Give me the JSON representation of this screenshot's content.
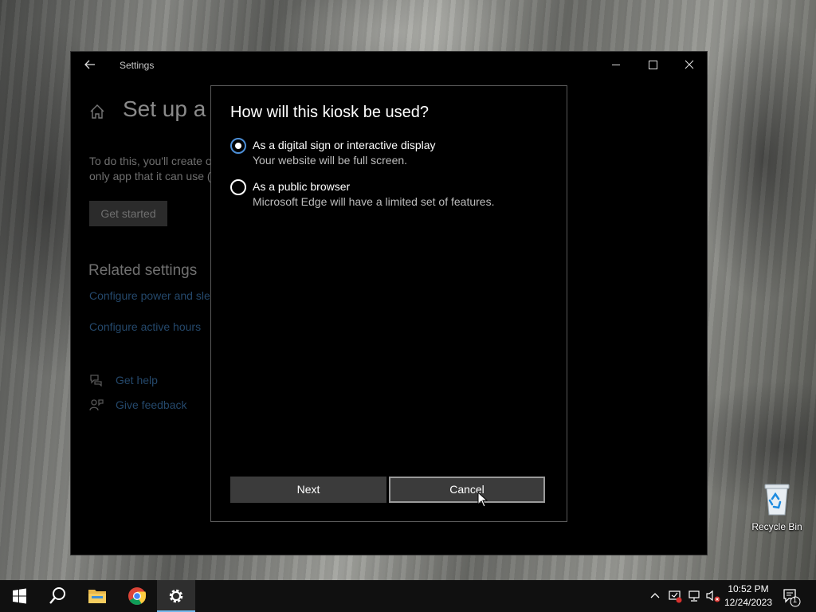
{
  "desktop": {
    "recycle_bin_label": "Recycle Bin"
  },
  "window": {
    "title": "Settings",
    "page_title": "Set up a kiosk",
    "description_lines": [
      "To do this, you'll create o",
      "only app that it can use ("
    ],
    "get_started_label": "Get started",
    "related_title": "Related settings",
    "related_links": [
      "Configure power and sleep",
      "Configure active hours"
    ],
    "help_label": "Get help",
    "feedback_label": "Give feedback"
  },
  "dialog": {
    "title": "How will this kiosk be used?",
    "options": [
      {
        "label": "As a digital sign or interactive display",
        "description": "Your website will be full screen.",
        "selected": true
      },
      {
        "label": "As a public browser",
        "description": "Microsoft Edge will have a limited set of features.",
        "selected": false
      }
    ],
    "next_label": "Next",
    "cancel_label": "Cancel"
  },
  "taskbar": {
    "time": "10:52 PM",
    "date": "12/24/2023",
    "notification_count": "1",
    "accent_color": "#76b9ed"
  },
  "colors": {
    "radio_selected": "#4c8ed6",
    "link": "#24486b"
  }
}
